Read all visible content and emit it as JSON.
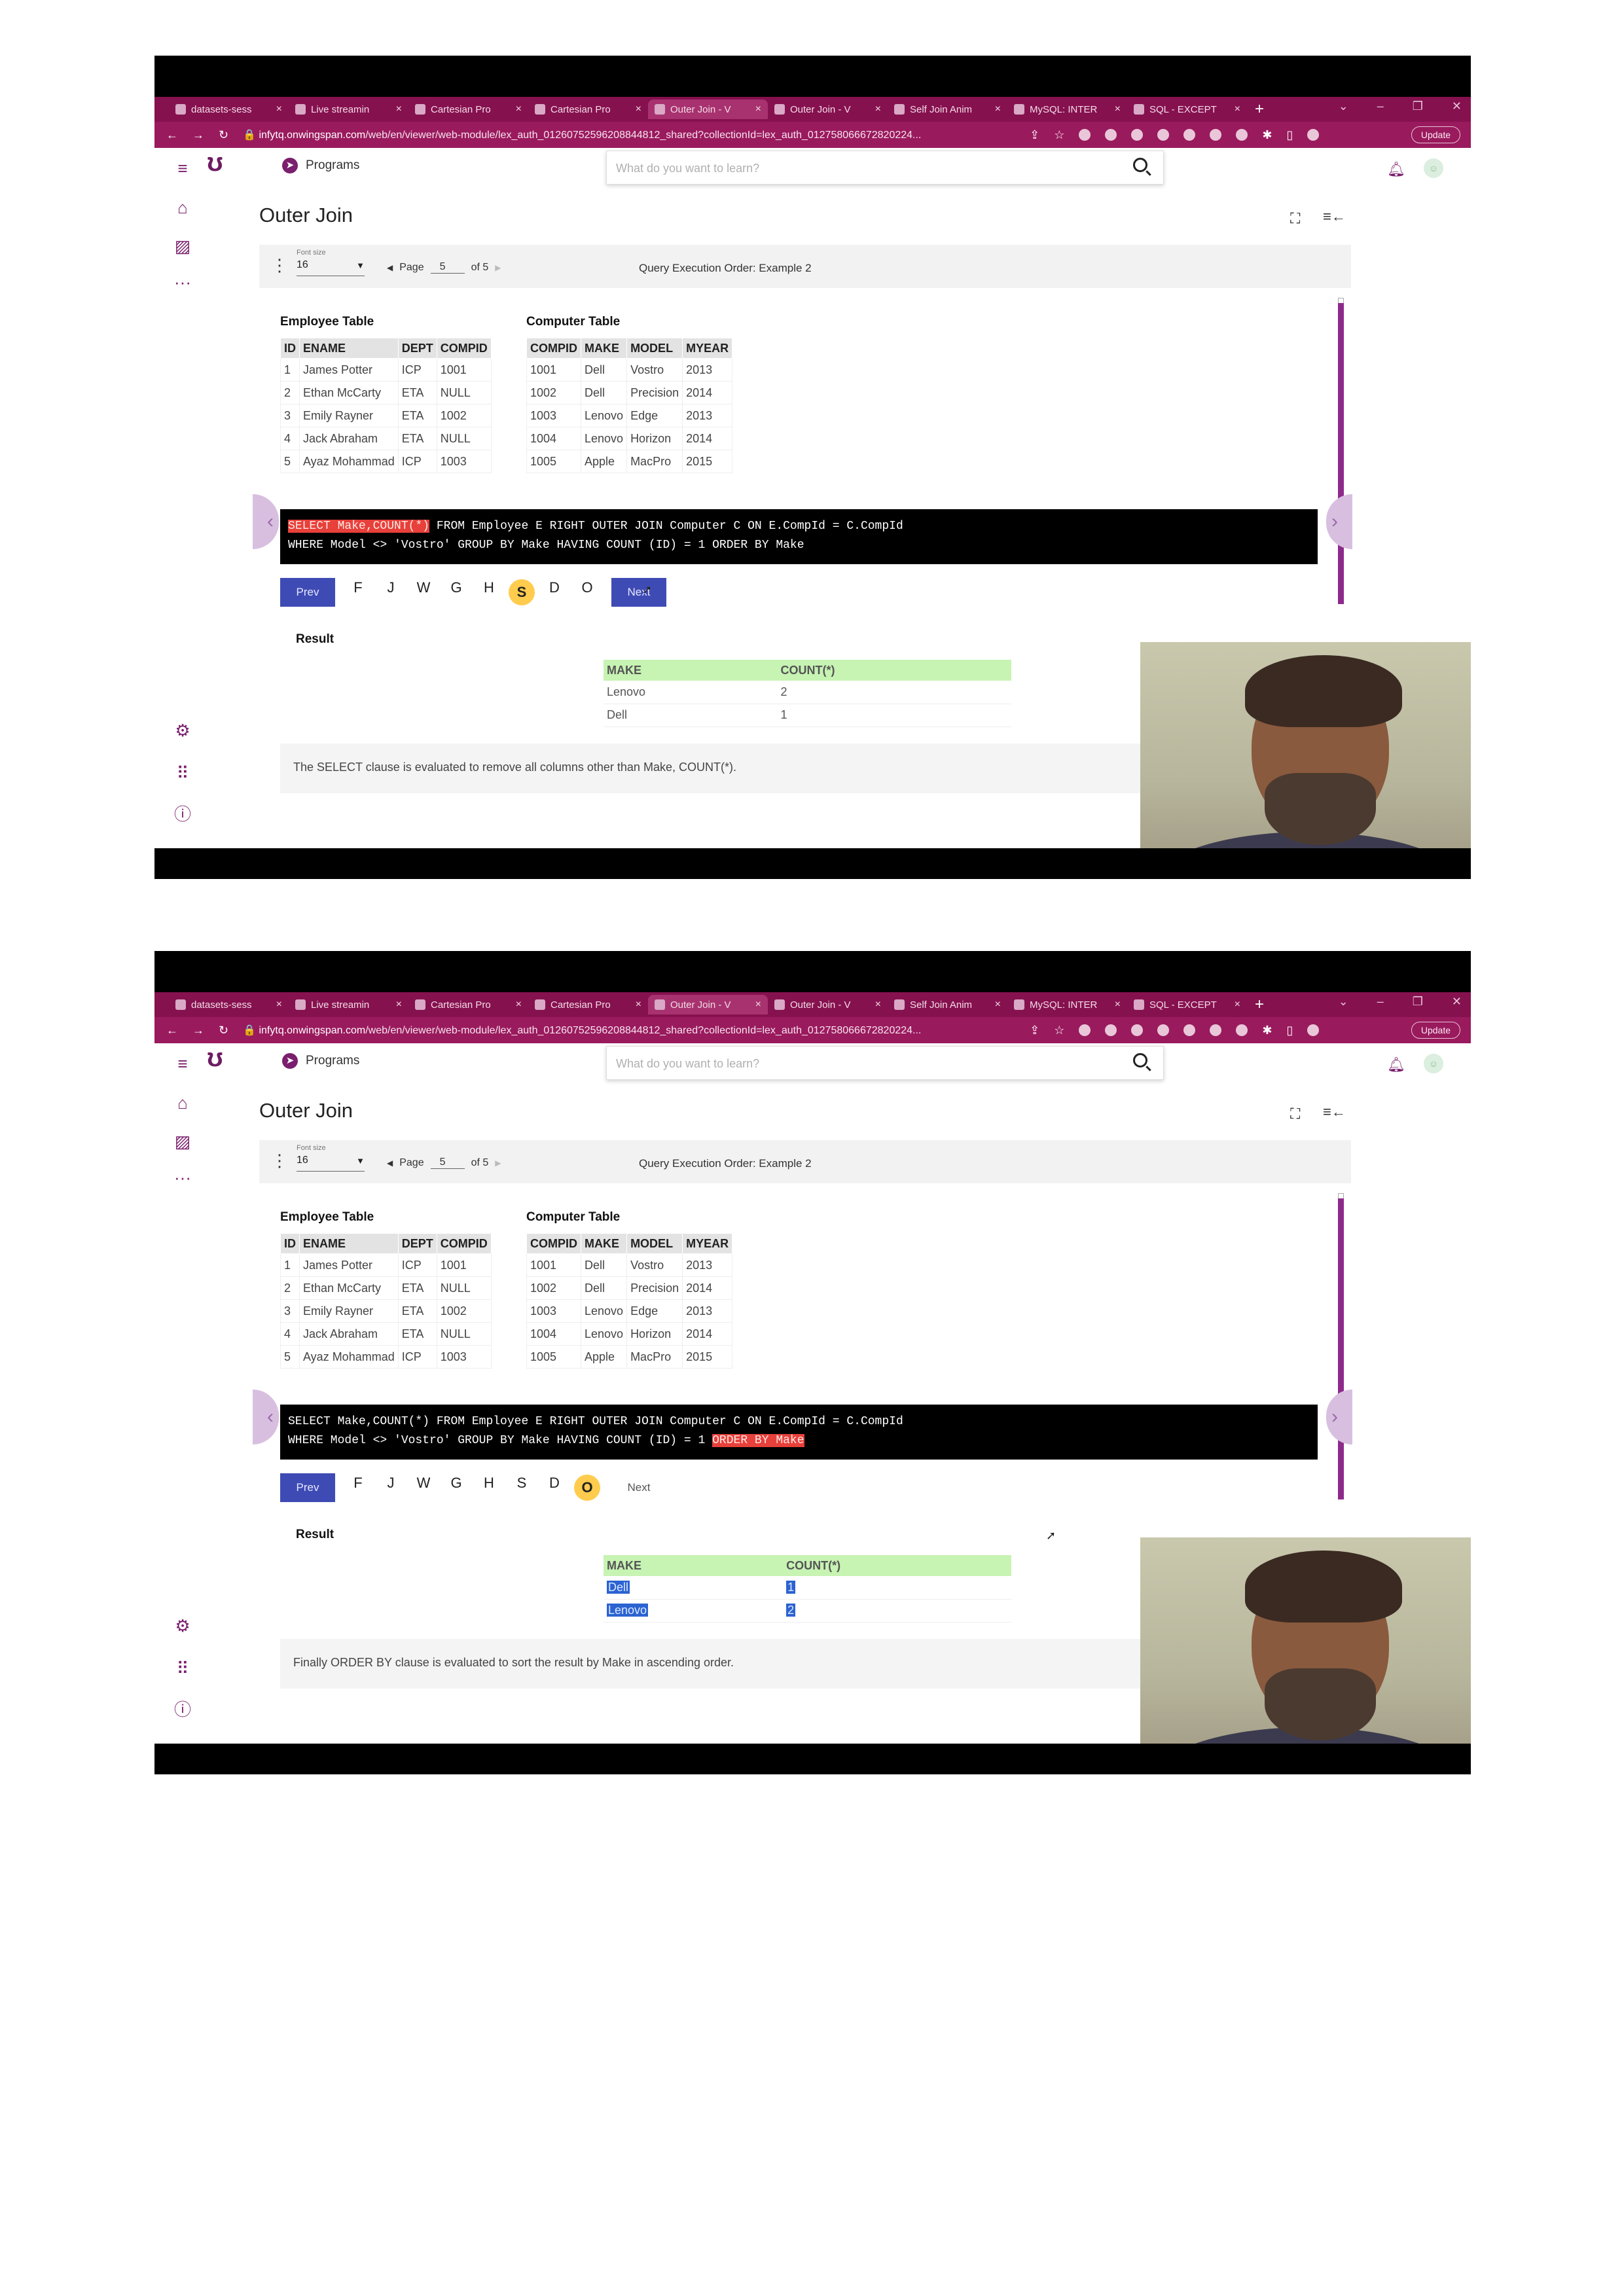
{
  "browser": {
    "tabs": [
      "datasets-sess",
      "Live streamin",
      "Cartesian Pro",
      "Cartesian Pro",
      "Outer Join - V",
      "Outer Join - V",
      "Self Join Anim",
      "MySQL: INTER",
      "SQL - EXCEPT"
    ],
    "new_tab": "+",
    "url_domain": "infytq.onwingspan.com",
    "url_path": "/web/en/viewer/web-module/lex_auth_01260752596208844812_shared?collectionId=lex_auth_012758066672820224...",
    "update_label": "Update"
  },
  "header": {
    "programs_label": "Programs",
    "search_placeholder": "What do you want to learn?"
  },
  "page_title": "Outer Join",
  "toolbar": {
    "font_size_label": "Font size",
    "font_size_value": "16",
    "page_label": "Page",
    "page_value": "5",
    "page_of": "of 5",
    "breadcrumb": "Query Execution Order: Example 2"
  },
  "employee_table": {
    "title": "Employee Table",
    "headers": [
      "ID",
      "ENAME",
      "DEPT",
      "COMPID"
    ],
    "rows": [
      [
        "1",
        "James Potter",
        "ICP",
        "1001"
      ],
      [
        "2",
        "Ethan McCarty",
        "ETA",
        "NULL"
      ],
      [
        "3",
        "Emily Rayner",
        "ETA",
        "1002"
      ],
      [
        "4",
        "Jack Abraham",
        "ETA",
        "NULL"
      ],
      [
        "5",
        "Ayaz Mohammad",
        "ICP",
        "1003"
      ]
    ]
  },
  "computer_table": {
    "title": "Computer Table",
    "headers": [
      "COMPID",
      "MAKE",
      "MODEL",
      "MYEAR"
    ],
    "rows": [
      [
        "1001",
        "Dell",
        "Vostro",
        "2013"
      ],
      [
        "1002",
        "Dell",
        "Precision",
        "2014"
      ],
      [
        "1003",
        "Lenovo",
        "Edge",
        "2013"
      ],
      [
        "1004",
        "Lenovo",
        "Horizon",
        "2014"
      ],
      [
        "1005",
        "Apple",
        "MacPro",
        "2015"
      ]
    ]
  },
  "buttons": {
    "prev": "Prev",
    "next": "Next"
  },
  "steps": [
    "F",
    "J",
    "W",
    "G",
    "H",
    "S",
    "D",
    "O"
  ],
  "result_label": "Result",
  "result_headers": [
    "MAKE",
    "COUNT(*)"
  ],
  "frames": [
    {
      "code": {
        "line1_hl": "SELECT Make,COUNT(*)",
        "line1_rest": " FROM Employee E RIGHT OUTER JOIN Computer C ON E.CompId = C.CompId",
        "line2_plain": "WHERE Model <> 'Vostro' GROUP BY Make HAVING COUNT (ID) = 1 ORDER BY Make",
        "line2_hl": ""
      },
      "active_step": "S",
      "result_rows": [
        [
          "Lenovo",
          "2"
        ],
        [
          "Dell",
          "1"
        ]
      ],
      "explanation": "The SELECT clause is evaluated to remove all columns other than Make, COUNT(*)."
    },
    {
      "code": {
        "line1_hl": "",
        "line1_rest": "SELECT Make,COUNT(*) FROM Employee E RIGHT OUTER JOIN Computer C ON E.CompId = C.CompId",
        "line2_plain": "WHERE Model <> 'Vostro' GROUP BY Make HAVING COUNT (ID) = 1 ",
        "line2_hl": "ORDER BY Make"
      },
      "active_step": "O",
      "result_rows": [
        [
          "Dell",
          "1"
        ],
        [
          "Lenovo",
          "2"
        ]
      ],
      "explanation": "Finally ORDER BY clause is evaluated to sort the result by Make in ascending order."
    }
  ],
  "colors": {
    "brand": "#86114f",
    "highlight": "#e8403a",
    "active_step": "#ffcc4d",
    "button": "#3f4bb4",
    "result_header": "#c7f3b3",
    "scrollbar": "#8e2a8c"
  },
  "icons": [
    "menu-icon",
    "home-icon",
    "image-icon",
    "more-icon",
    "settings-icon",
    "apps-icon",
    "info-icon",
    "search-icon",
    "bell-icon",
    "fullscreen-icon",
    "toc-icon",
    "compass-icon"
  ]
}
